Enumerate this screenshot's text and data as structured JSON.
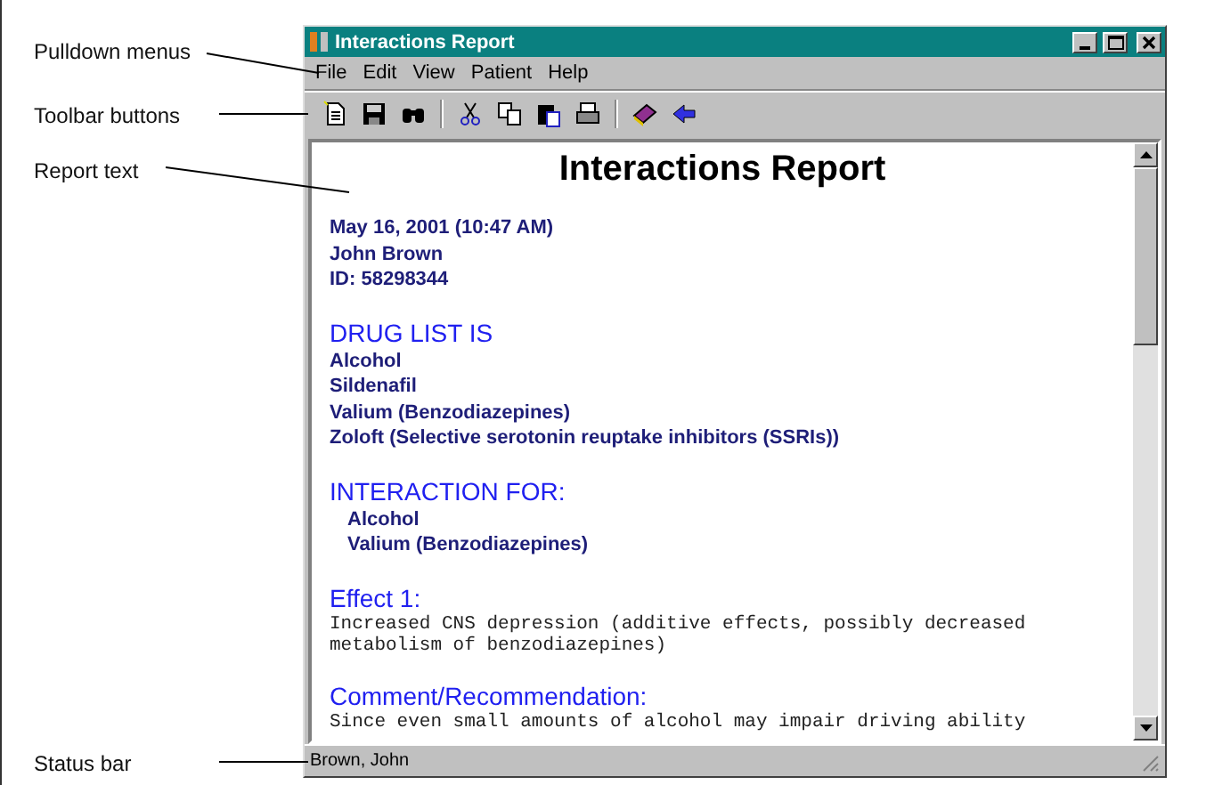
{
  "annotations": [
    {
      "label": "Pulldown menus"
    },
    {
      "label": "Toolbar buttons"
    },
    {
      "label": "Report text"
    },
    {
      "label": "Status bar"
    }
  ],
  "window": {
    "title": "Interactions Report"
  },
  "menus": [
    {
      "label": "File"
    },
    {
      "label": "Edit"
    },
    {
      "label": "View"
    },
    {
      "label": "Patient"
    },
    {
      "label": "Help"
    }
  ],
  "report": [
    {
      "kind": "title",
      "text": "Interactions Report"
    },
    {
      "kind": "info",
      "text": "May 16, 2001 (10:47 AM)"
    },
    {
      "kind": "info",
      "text": "John Brown"
    },
    {
      "kind": "info",
      "text": "ID: 58298344"
    },
    {
      "kind": "heading",
      "text": "DRUG LIST IS"
    },
    {
      "kind": "item",
      "text": "Alcohol"
    },
    {
      "kind": "item",
      "text": "Sildenafil"
    },
    {
      "kind": "item",
      "text": "Valium (Benzodiazepines)"
    },
    {
      "kind": "item",
      "text": "Zoloft (Selective serotonin reuptake inhibitors (SSRIs))"
    },
    {
      "kind": "heading",
      "text": "INTERACTION FOR:"
    },
    {
      "kind": "indented",
      "text": "Alcohol"
    },
    {
      "kind": "indented",
      "text": "Valium (Benzodiazepines)"
    },
    {
      "kind": "heading",
      "text": "Effect 1:"
    },
    {
      "kind": "mono",
      "text": "Increased CNS depression (additive effects, possibly decreased\nmetabolism of benzodiazepines)"
    },
    {
      "kind": "heading",
      "text": "Comment/Recommendation:"
    },
    {
      "kind": "mono",
      "text": "Since even small amounts of alcohol may impair driving ability"
    }
  ],
  "status_bar": {
    "text": "Brown, John"
  }
}
